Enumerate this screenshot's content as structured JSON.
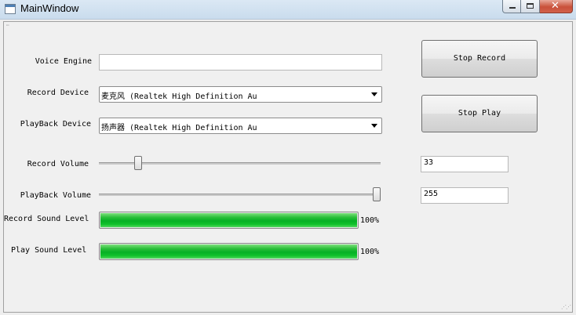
{
  "window": {
    "title": "MainWindow",
    "close_glyph": "✕"
  },
  "labels": {
    "voice_engine": "Voice Engine",
    "record_device": "Record Device",
    "playback_device": "PlayBack Device",
    "record_volume": "Record Volume",
    "playback_volume": "PlayBack Volume",
    "record_sound_level": "Record Sound Level",
    "play_sound_level": "Play Sound Level"
  },
  "fields": {
    "voice_engine_value": "",
    "record_device_selected": "麦克风 (Realtek High Definition Au",
    "playback_device_selected": "扬声器 (Realtek High Definition Au",
    "record_volume_value": "33",
    "playback_volume_value": "255"
  },
  "sliders": {
    "record_volume": 33,
    "playback_volume": 255,
    "max": 255
  },
  "levels": {
    "record_sound_level_text": "100%",
    "record_sound_level": 100,
    "play_sound_level_text": "100%",
    "play_sound_level": 100
  },
  "buttons": {
    "stop_record": "Stop Record",
    "stop_play": "Stop Play"
  },
  "colors": {
    "progress_green": "#06b025",
    "close_red": "#c9513a"
  }
}
